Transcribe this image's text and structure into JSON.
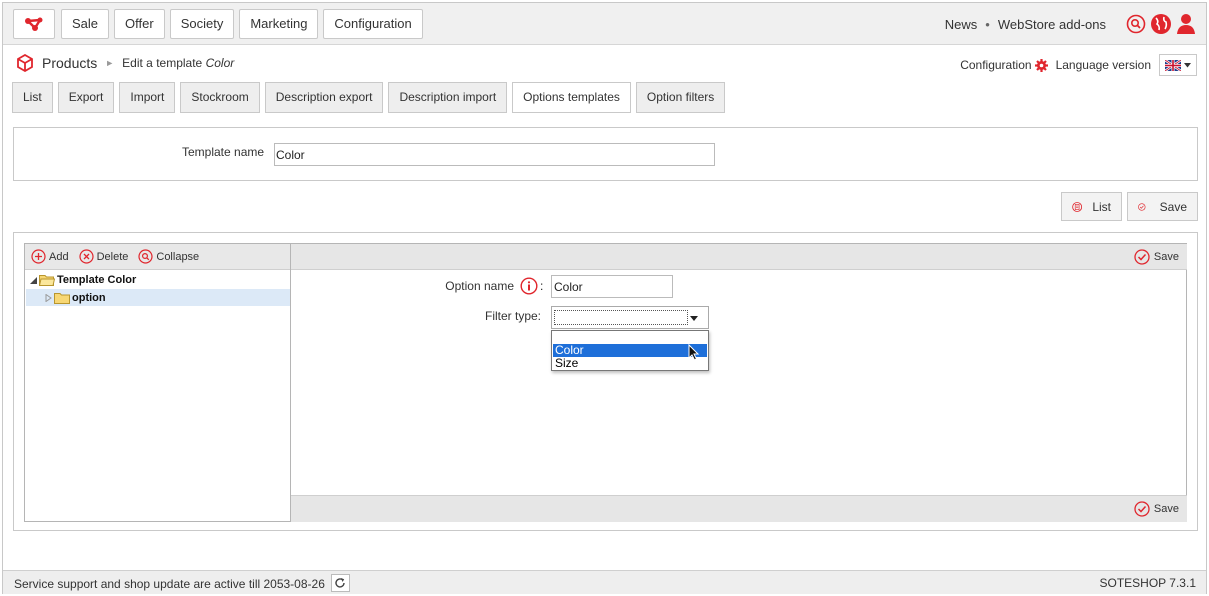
{
  "topbar": {
    "menu": [
      "Sale",
      "Offer",
      "Society",
      "Marketing",
      "Configuration"
    ],
    "news": "News",
    "separator": "•",
    "addons": "WebStore add-ons",
    "icons": [
      "search-icon",
      "globe-icon",
      "user-icon"
    ]
  },
  "breadcrumb": {
    "title": "Products",
    "arrow": "►",
    "sub_prefix": "Edit a template",
    "sub_italic": "Color"
  },
  "header_right": {
    "configuration": "Configuration",
    "language_version": "Language version"
  },
  "tabs": [
    "List",
    "Export",
    "Import",
    "Stockroom",
    "Description export",
    "Description import",
    "Options templates",
    "Option filters"
  ],
  "active_tab": "Options templates",
  "template": {
    "label": "Template name",
    "value": "Color"
  },
  "actions": {
    "list": "List",
    "save": "Save"
  },
  "tree": {
    "add": "Add",
    "delete": "Delete",
    "collapse": "Collapse",
    "root": "Template Color",
    "child": "option"
  },
  "editor": {
    "save": "Save",
    "option_name_label": "Option name",
    "option_name_value": "Color",
    "filter_type_label": "Filter type:",
    "filter_options": [
      "Color",
      "Size"
    ],
    "highlighted_option": "Color"
  },
  "footer": {
    "support": "Service support and shop update are active till 2053-08-26",
    "version": "SOTESHOP 7.3.1"
  },
  "colors": {
    "accent": "#e0262d",
    "highlight": "#1e6fd9",
    "selection": "#dce9f7"
  }
}
